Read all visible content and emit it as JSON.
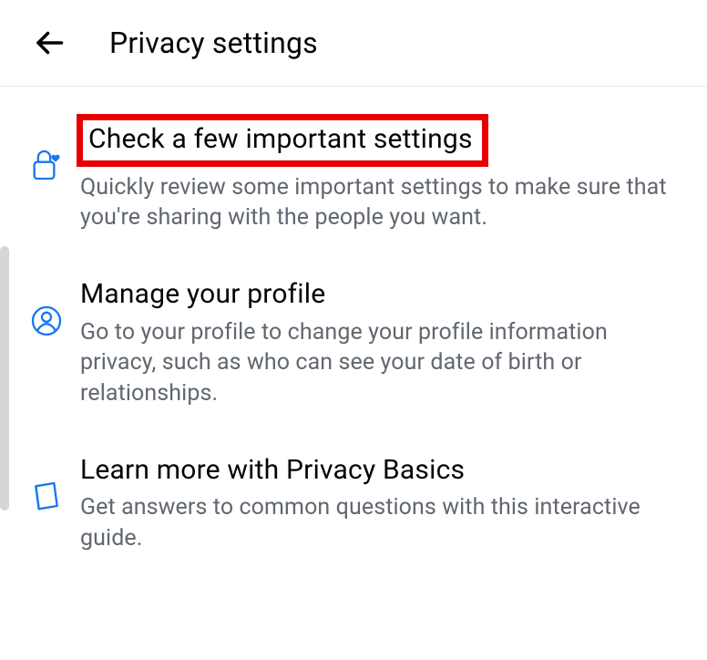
{
  "header": {
    "title": "Privacy settings"
  },
  "items": [
    {
      "title": "Check a few important settings",
      "desc": "Quickly review some important settings to make sure that you're sharing with the people you want."
    },
    {
      "title": "Manage your profile",
      "desc": "Go to your profile to change your profile information privacy, such as who can see your date of birth or relationships."
    },
    {
      "title": "Learn more with Privacy Basics",
      "desc": "Get answers to common questions with this interactive guide."
    }
  ]
}
